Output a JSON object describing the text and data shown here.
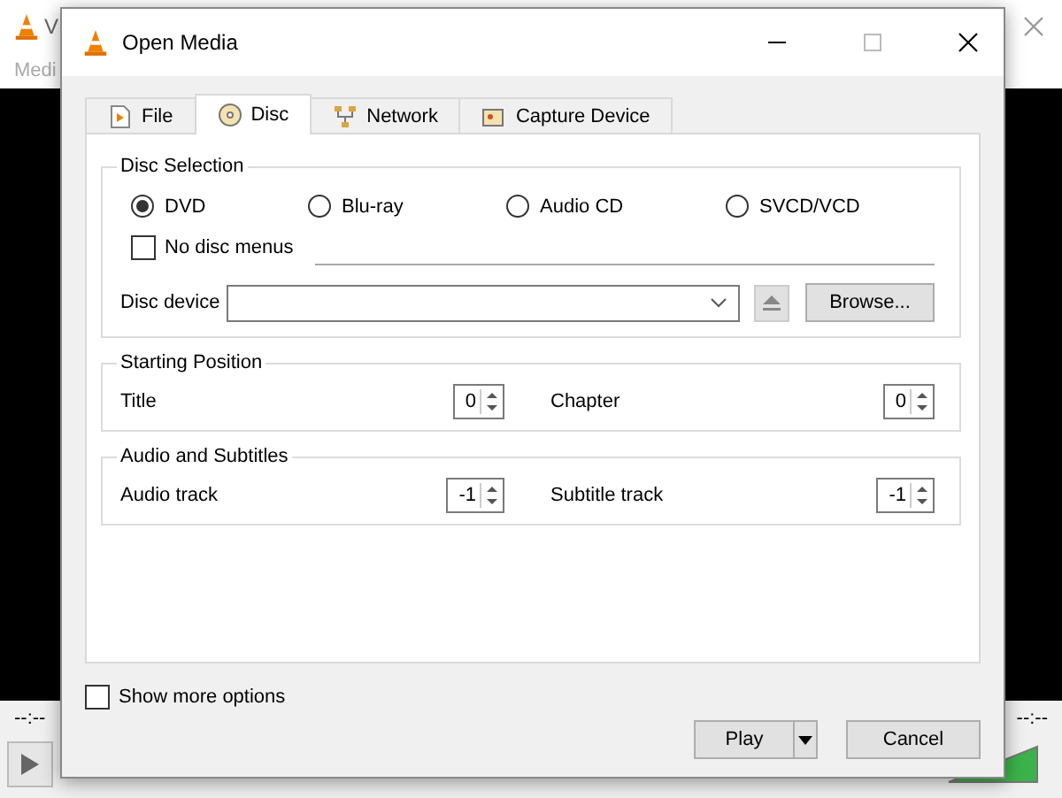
{
  "background_window": {
    "title": "V",
    "menu": [
      "Medi"
    ],
    "elapsed": "--:--",
    "remaining": "--:--"
  },
  "dialog": {
    "title": "Open Media"
  },
  "tabs": [
    {
      "label": "File",
      "kind": "file",
      "selected": false
    },
    {
      "label": "Disc",
      "kind": "disc",
      "selected": true
    },
    {
      "label": "Network",
      "kind": "network",
      "selected": false
    },
    {
      "label": "Capture Device",
      "kind": "capture",
      "selected": false
    }
  ],
  "disc_selection": {
    "title": "Disc Selection",
    "types": [
      {
        "label": "DVD",
        "selected": true
      },
      {
        "label": "Blu-ray",
        "selected": false
      },
      {
        "label": "Audio CD",
        "selected": false
      },
      {
        "label": "SVCD/VCD",
        "selected": false
      }
    ],
    "no_disc_menus": {
      "label": "No disc menus",
      "checked": false
    },
    "device_label": "Disc device",
    "browse": "Browse..."
  },
  "starting_position": {
    "title": "Starting Position",
    "fields": [
      {
        "label": "Title",
        "value": "0"
      },
      {
        "label": "Chapter",
        "value": "0"
      }
    ]
  },
  "audio_and_subtitles": {
    "title": "Audio and Subtitles",
    "fields": [
      {
        "label": "Audio track",
        "value": "-1"
      },
      {
        "label": "Subtitle track",
        "value": "-1"
      }
    ]
  },
  "show_more_options": {
    "label": "Show more options",
    "checked": false
  },
  "buttons": {
    "play": "Play",
    "cancel": "Cancel"
  }
}
